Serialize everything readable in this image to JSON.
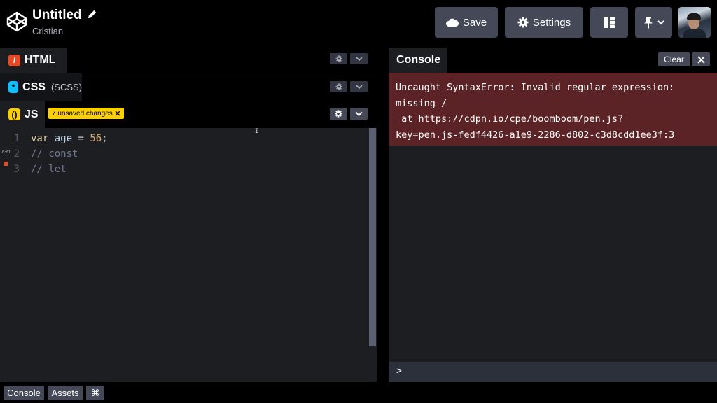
{
  "header": {
    "title": "Untitled",
    "author": "Cristian",
    "save_label": "Save",
    "settings_label": "Settings"
  },
  "editors": {
    "html": {
      "label": "HTML"
    },
    "css": {
      "label": "CSS",
      "sub": "(SCSS)"
    },
    "js": {
      "label": "JS",
      "badge": "7 unsaved changes"
    }
  },
  "code": {
    "lines": [
      {
        "num": "1",
        "kw": "var",
        "var": " age",
        "op": " = ",
        "num_val": "56",
        "end": ";"
      },
      {
        "num": "2",
        "comment": "// const"
      },
      {
        "num": "3",
        "comment": "// let"
      }
    ],
    "gutter_marker": "0:01"
  },
  "console": {
    "tab_label": "Console",
    "clear_label": "Clear",
    "error_text": "Uncaught SyntaxError: Invalid regular expression:\nmissing /\n at https://cdpn.io/cpe/boomboom/pen.js?\nkey=pen.js-fedf4426-a1e9-2286-d802-c3d8cdd1ee3f:3",
    "prompt": ">"
  },
  "footer": {
    "console_label": "Console",
    "assets_label": "Assets",
    "shortcut_label": "⌘"
  },
  "colors": {
    "error_bg": "#5b2326",
    "js_accent": "#fcd000",
    "css_accent": "#0ebeff",
    "html_accent": "#e34c26"
  }
}
